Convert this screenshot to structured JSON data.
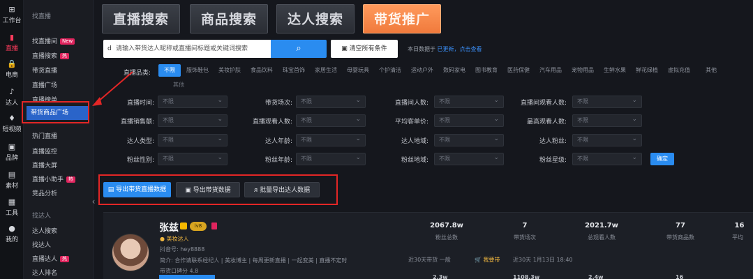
{
  "rail": [
    {
      "icon": "⊞",
      "label": "工作台",
      "name": "rail-workbench"
    },
    {
      "icon": "▮",
      "label": "直播",
      "name": "rail-live",
      "active": true
    },
    {
      "icon": "🔒",
      "label": "电商",
      "name": "rail-ecommerce"
    },
    {
      "icon": "♪",
      "label": "达人",
      "name": "rail-talent"
    },
    {
      "icon": "♦",
      "label": "短视频",
      "name": "rail-short-video"
    },
    {
      "icon": "▣",
      "label": "品牌",
      "name": "rail-brand"
    },
    {
      "icon": "▤",
      "label": "素材",
      "name": "rail-material"
    },
    {
      "icon": "▦",
      "label": "工具",
      "name": "rail-tools"
    },
    {
      "icon": "●",
      "label": "我的",
      "name": "rail-mine"
    }
  ],
  "submenu": {
    "head1": "找直播",
    "items1": [
      {
        "label": "找直播间",
        "badge": "New"
      },
      {
        "label": "直播搜索",
        "badge": "热"
      },
      {
        "label": "带货直播"
      },
      {
        "label": "直播广场"
      },
      {
        "label": "直播榜单"
      },
      {
        "label": "带货商品广场",
        "active": true
      }
    ],
    "items2": [
      {
        "label": "热门直播"
      },
      {
        "label": "直播监控"
      },
      {
        "label": "直播大屏"
      },
      {
        "label": "直播小助手",
        "badge": "热"
      },
      {
        "label": "竞品分析"
      }
    ],
    "head2": "找达人",
    "items3": [
      {
        "label": "达人搜索"
      },
      {
        "label": "找达人"
      },
      {
        "label": "直播达人",
        "badge": "热"
      },
      {
        "label": "达人排名"
      }
    ]
  },
  "tabs": [
    {
      "label": "直播搜索",
      "name": "tab-live-search"
    },
    {
      "label": "商品搜索",
      "name": "tab-product-search"
    },
    {
      "label": "达人搜索",
      "name": "tab-talent-search"
    },
    {
      "label": "带货推广",
      "name": "tab-promotion",
      "active": true
    }
  ],
  "search": {
    "prefix": "d",
    "placeholder": "请输入带货达人昵称或直播间标题或关键词搜索",
    "button_icon": "⌕",
    "clear_label": "清空所有条件",
    "hint_text": "本日数据于",
    "hint_link": "已更新，点击查看"
  },
  "categories": {
    "label": "直播品类:",
    "items": [
      "不限",
      "服饰鞋包",
      "美妆护肤",
      "食品饮料",
      "珠宝首饰",
      "家居生活",
      "母婴玩具",
      "个护清洁",
      "运动户外",
      "数码家电",
      "图书教育",
      "医药保健",
      "汽车用品",
      "宠物用品",
      "生鲜水果",
      "鲜花绿植",
      "虚拟充值",
      "其他"
    ],
    "more": "其他"
  },
  "filters": [
    [
      {
        "label": "直播时间:",
        "value": "不限"
      },
      {
        "label": "带货场次:",
        "value": "不限"
      },
      {
        "label": "直播间人数:",
        "value": "不限"
      },
      {
        "label": "直播间观看人数:",
        "value": "不限"
      }
    ],
    [
      {
        "label": "直播销售额:",
        "value": "不限"
      },
      {
        "label": "直播观看人数:",
        "value": "不限"
      },
      {
        "label": "平均客单价:",
        "value": "不限"
      },
      {
        "label": "最高观看人数:",
        "value": "不限"
      }
    ],
    [
      {
        "label": "达人类型:",
        "value": "不限"
      },
      {
        "label": "达人年龄:",
        "value": "不限"
      },
      {
        "label": "达人地域:",
        "value": "不限"
      },
      {
        "label": "达人粉丝:",
        "value": "不限"
      }
    ],
    [
      {
        "label": "粉丝性别:",
        "value": "不限"
      },
      {
        "label": "粉丝年龄:",
        "value": "不限"
      },
      {
        "label": "粉丝地域:",
        "value": "不限"
      },
      {
        "label": "粉丝星级:",
        "value": "不限"
      }
    ]
  ],
  "confirm_label": "确定",
  "actions": [
    {
      "label": "导出带货直播数据",
      "style": "primary",
      "icon": "▤"
    },
    {
      "label": "导出带货数据",
      "style": "dark",
      "icon": "▣"
    },
    {
      "label": "批量导出达人数据",
      "style": "dark",
      "icon": "ᴙ"
    }
  ],
  "result": {
    "name": "张兹",
    "level": "lv8",
    "tag": "● 美妆达人",
    "meta1": "抖音号: hey8888",
    "meta2": "简介: 合作请联系经纪人 | 美妆博主 | 每周更新直播 | 一起变美 | 直播不定时",
    "meta3": "带货口碑分 4.8",
    "stats": [
      {
        "value": "2067.8w",
        "label": "粉丝总数"
      },
      {
        "value": "7",
        "label": "带货场次"
      },
      {
        "value": "2021.7w",
        "label": "总观看人数"
      },
      {
        "value": "77",
        "label": "带货商品数"
      },
      {
        "value": "16",
        "label": "平均"
      }
    ],
    "sub1": "近30天带货 一般",
    "sub2": "我要带",
    "sub3": "近30天 1月13日 18:40",
    "next_values": [
      "2.3w",
      "1108.3w",
      "2.4w",
      "16"
    ]
  }
}
